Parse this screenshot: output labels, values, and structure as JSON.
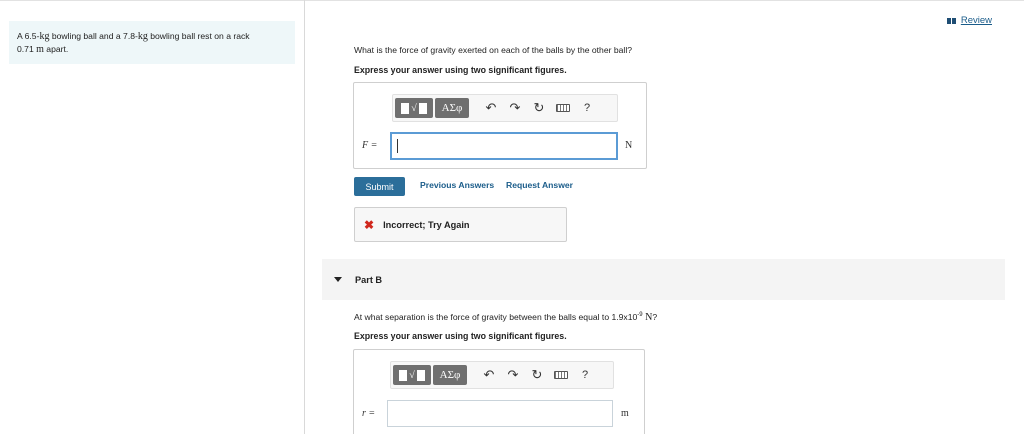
{
  "problem": {
    "pre": "A 6.5-",
    "unit1": "kg",
    "mid": " bowling ball and a 7.8-",
    "unit2": "kg",
    "post": " bowling ball rest on a rack",
    "line2_val": "0.71 ",
    "unit3": "m",
    "line2_post": " apart."
  },
  "review": {
    "label": "Review"
  },
  "part_a": {
    "question": "What is the force of gravity exerted on each of the balls by the other ball?",
    "instruction": "Express your answer using two significant figures.",
    "var_label": "F =",
    "unit": "N",
    "input_value": "",
    "toolbar": {
      "root_symbol": "√",
      "greek": "ΑΣφ",
      "undo": "↶",
      "redo": "↷",
      "reset": "↻",
      "help": "?"
    },
    "submit_label": "Submit",
    "previous_answers": "Previous Answers",
    "request_answer": "Request Answer",
    "feedback": {
      "icon": "✖",
      "text": "Incorrect; Try Again"
    }
  },
  "part_b": {
    "title": "Part B",
    "question_pre": "At what separation is the force of gravity between the balls equal to 1.9x10",
    "question_exp": "-9",
    "question_unit": " N",
    "question_post": "?",
    "instruction": "Express your answer using two significant figures.",
    "var_label": "r =",
    "unit": "m",
    "input_value": "",
    "toolbar": {
      "root_symbol": "√",
      "greek": "ΑΣφ",
      "undo": "↶",
      "redo": "↷",
      "reset": "↻",
      "help": "?"
    }
  }
}
